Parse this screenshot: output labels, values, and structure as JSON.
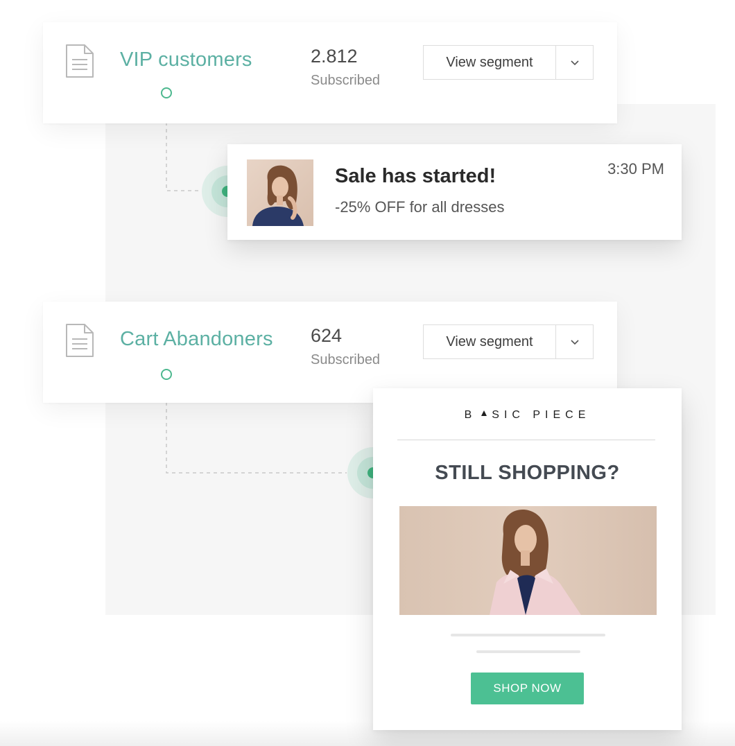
{
  "colors": {
    "accent_teal": "#5cb0a3",
    "accent_green": "#3fb37f",
    "button_green": "#4cc093",
    "headline_gray": "#444a52"
  },
  "segments": [
    {
      "name": "VIP customers",
      "count": "2.812",
      "subscribed_label": "Subscribed",
      "action_label": "View segment",
      "icon": "document-icon",
      "dropdown_icon": "chevron-down-icon"
    },
    {
      "name": "Cart Abandoners",
      "count": "624",
      "subscribed_label": "Subscribed",
      "action_label": "View segment",
      "icon": "document-icon",
      "dropdown_icon": "chevron-down-icon"
    }
  ],
  "notification": {
    "title": "Sale has started!",
    "body": "-25% OFF for all dresses",
    "time": "3:30 PM"
  },
  "email": {
    "brand_prefix": "B",
    "brand_suffix": "SIC PIECE",
    "headline": "STILL SHOPPING?",
    "cta_label": "SHOP NOW"
  }
}
